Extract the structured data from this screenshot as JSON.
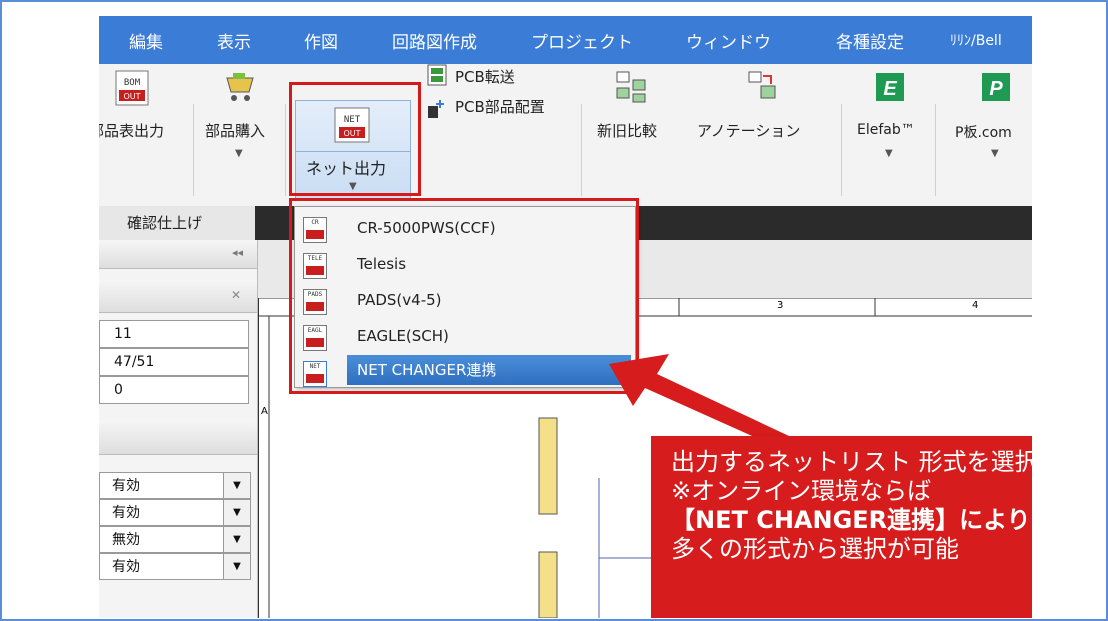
{
  "menubar": {
    "items": [
      "編集",
      "表示",
      "作図",
      "回路図作成",
      "プロジェクト",
      "ウィンドウ",
      "各種設定",
      "ﾘﾘﾝ/Bell"
    ]
  },
  "ribbon": {
    "bom_icon_top": "BOM",
    "bom_icon_bottom": "OUT",
    "bom_label": "部品表出力",
    "purchase_label": "部品購入",
    "net_icon_top": "NET",
    "net_icon_bottom": "OUT",
    "net_label": "ネット出力",
    "pcb_transfer_label": "PCB転送",
    "pcb_place_label": "PCB部品配置",
    "compare_label": "新旧比較",
    "annotation_label": "アノテーション",
    "elefab_label": "Elefab™",
    "pboard_label": "P板.com"
  },
  "tabs": {
    "active": "確認仕上げ"
  },
  "left_panel": {
    "values": [
      "11",
      "47/51",
      "0"
    ],
    "selects": [
      "有効",
      "有効",
      "無効",
      "有効"
    ]
  },
  "sheet": {
    "col3": "3",
    "col4": "4",
    "rowA": "A"
  },
  "dropdown": {
    "items": [
      {
        "icon": "CR",
        "label": "CR-5000PWS(CCF)"
      },
      {
        "icon": "TELE",
        "label": "Telesis"
      },
      {
        "icon": "PADS",
        "label": "PADS(v4-5)"
      },
      {
        "icon": "EAGL",
        "label": "EAGLE(SCH)"
      },
      {
        "icon": "NET",
        "label": "NET CHANGER連携"
      }
    ]
  },
  "callout": {
    "lines": [
      "出力するネットリスト 形式を選択",
      "※オンライン環境ならば",
      "【NET CHANGER連携】により",
      "多くの形式から選択が可能"
    ]
  },
  "colors": {
    "menubar": "#3a7cd6",
    "highlight_red": "#d41a1a",
    "frame": "#5b8ed6"
  }
}
